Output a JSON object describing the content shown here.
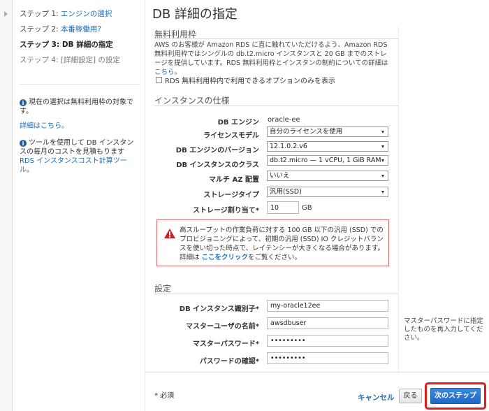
{
  "sidebar": {
    "steps": [
      {
        "prefix": "ステップ 1: ",
        "label": "エンジンの選択"
      },
      {
        "prefix": "ステップ 2: ",
        "label": "本番稼働用?"
      },
      {
        "prefix": "",
        "label": "ステップ 3: DB 詳細の指定"
      },
      {
        "prefix": "",
        "label": "ステップ 4: [詳細設定] の設定"
      }
    ],
    "free_tier_notice": "現在の選択は無料利用枠の対象です。",
    "details_link": "詳細はこちら。",
    "cost_tool_text": "ツールを使用して DB インスタンスの毎月のコストを見積もります ",
    "cost_tool_link": "RDS インスタンスコスト計算ツール",
    "cost_tool_suffix": "。"
  },
  "page_title": "DB 詳細の指定",
  "free_tier": {
    "title": "無料利用枠",
    "description": "AWS のお客様が Amazon RDS に直に触れていただけるよう、Amazon RDS 無料利用枠ではシングルの db.t2.micro インスタンスと 20 GB までのストレージを提供しています。RDS 無料利用枠とインスタンの制約についての詳細は",
    "description_link": "こちら",
    "description_suffix": "。",
    "checkbox_label": "RDS 無料利用枠内で利用できるオプションのみを表示"
  },
  "instance_spec": {
    "title": "インスタンスの仕様",
    "db_engine_label": "DB エンジン",
    "db_engine_value": "oracle-ee",
    "license_label": "ライセンスモデル",
    "license_value": "自分のライセンスを使用",
    "version_label": "DB エンジンのバージョン",
    "version_value": "12.1.0.2.v6",
    "class_label": "DB インスタンスのクラス",
    "class_value": "db.t2.micro — 1 vCPU, 1 GiB RAM",
    "multi_az_label": "マルチ AZ 配置",
    "multi_az_value": "いいえ",
    "storage_type_label": "ストレージタイプ",
    "storage_type_value": "汎用(SSD)",
    "storage_alloc_label": "ストレージ割り当て*",
    "storage_alloc_value": "10",
    "storage_unit": "GB"
  },
  "warning": {
    "text": "高スループットの作業負荷に対する 100 GB 以下の汎用 (SSD) でのプロビジョニングによって、初期の汎用 (SSD) IO クレジットバランスを使い切った時点で、レイテンシーが大きくなる場合があります。詳細は ",
    "link": "ここをクリック",
    "suffix": "をご覧ください。"
  },
  "settings": {
    "title": "設定",
    "identifier_label": "DB インスタンス識別子*",
    "identifier_value": "my-oracle12ee",
    "username_label": "マスターユーザの名前*",
    "username_value": "awsdbuser",
    "password_label": "マスターパスワード*",
    "password_value": "•••••••••",
    "confirm_label": "パスワードの確認*",
    "confirm_value": "•••••••••",
    "hint": "マスターパスワードに指定したものを再入力してください。"
  },
  "footer": {
    "required": "* 必須",
    "cancel": "キャンセル",
    "back": "戻る",
    "next": "次のステップ"
  },
  "colors": {
    "link": "#1a6fb5",
    "primary_button": "#2a78d4",
    "highlight_outline": "#e21b1b",
    "warning_border": "#d96a6a"
  }
}
